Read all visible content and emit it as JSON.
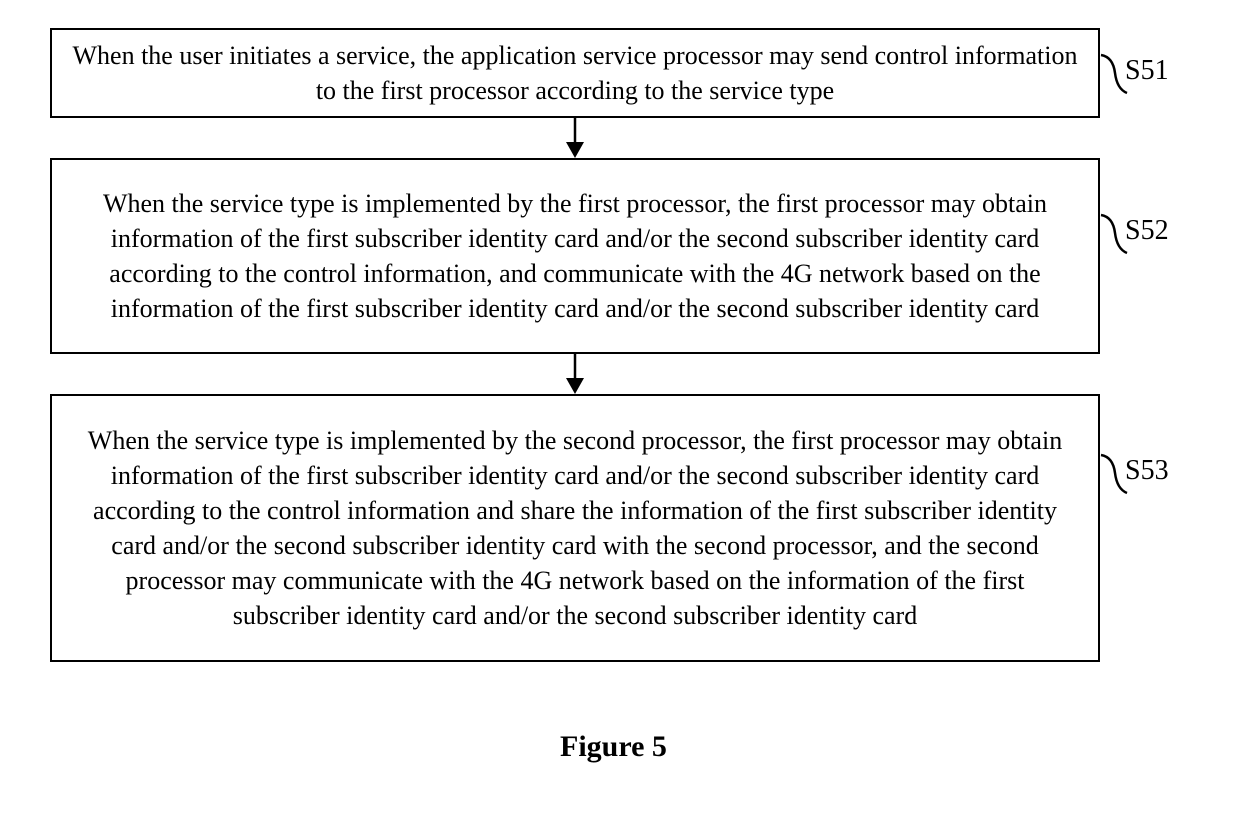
{
  "steps": {
    "s51": {
      "text": "When the user initiates a service, the application service processor may send control information to the first processor according to the service type",
      "label": "S51"
    },
    "s52": {
      "text": "When the service type is implemented by the first processor, the first processor may obtain information of the first subscriber identity card and/or the second subscriber identity card according to the control information, and communicate with the 4G network based on the information of the first subscriber identity card and/or the second subscriber identity card",
      "label": "S52"
    },
    "s53": {
      "text": "When the service type is implemented by the second processor, the first processor may obtain information of the first subscriber identity card and/or the second subscriber identity card according to the control information and share the information of the first subscriber identity card and/or the second subscriber identity card with the second processor, and the second processor may communicate with the 4G network based on the information of the first subscriber identity card and/or the second subscriber identity card",
      "label": "S53"
    }
  },
  "caption": "Figure 5"
}
